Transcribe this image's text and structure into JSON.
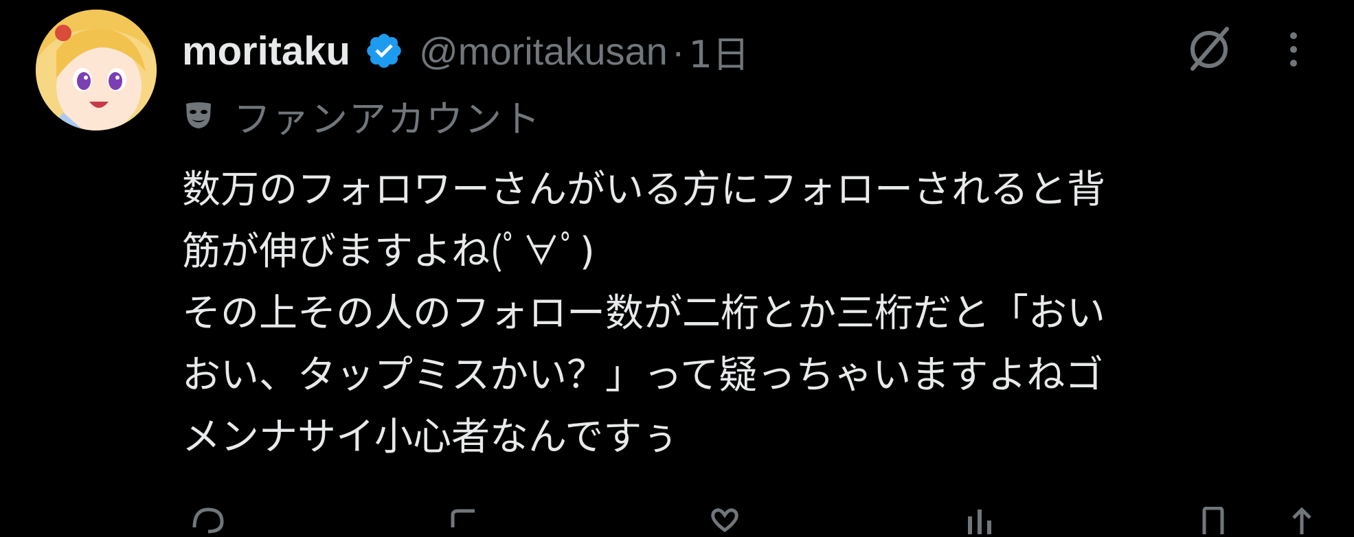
{
  "tweet": {
    "display_name": "moritaku",
    "handle": "@moritakusan",
    "separator": "·",
    "time": "1日",
    "label": "ファンアカウント",
    "body_lines": [
      "数万のフォロワーさんがいる方にフォローされると背",
      "筋が伸びますよね(ﾟ∀ﾟ)",
      "その上その人のフォロー数が二桁とか三桁だと「おい",
      "おい、タップミスかい？」って疑っちゃいますよねゴ",
      "メンナサイ小心者なんですぅ"
    ]
  },
  "icons": {
    "avatar": "avatar",
    "verified": "verified-badge-icon",
    "grok": "grok-icon",
    "more": "more-options-icon",
    "label": "theater-mask-icon",
    "reply": "reply-icon",
    "repost": "repost-icon",
    "like": "like-icon",
    "views": "views-icon",
    "bookmark": "bookmark-icon",
    "share": "share-icon"
  },
  "colors": {
    "background": "#000000",
    "primary_text": "#e7e9ea",
    "secondary_text": "#71767b",
    "verified_blue": "#1d9bf0"
  }
}
